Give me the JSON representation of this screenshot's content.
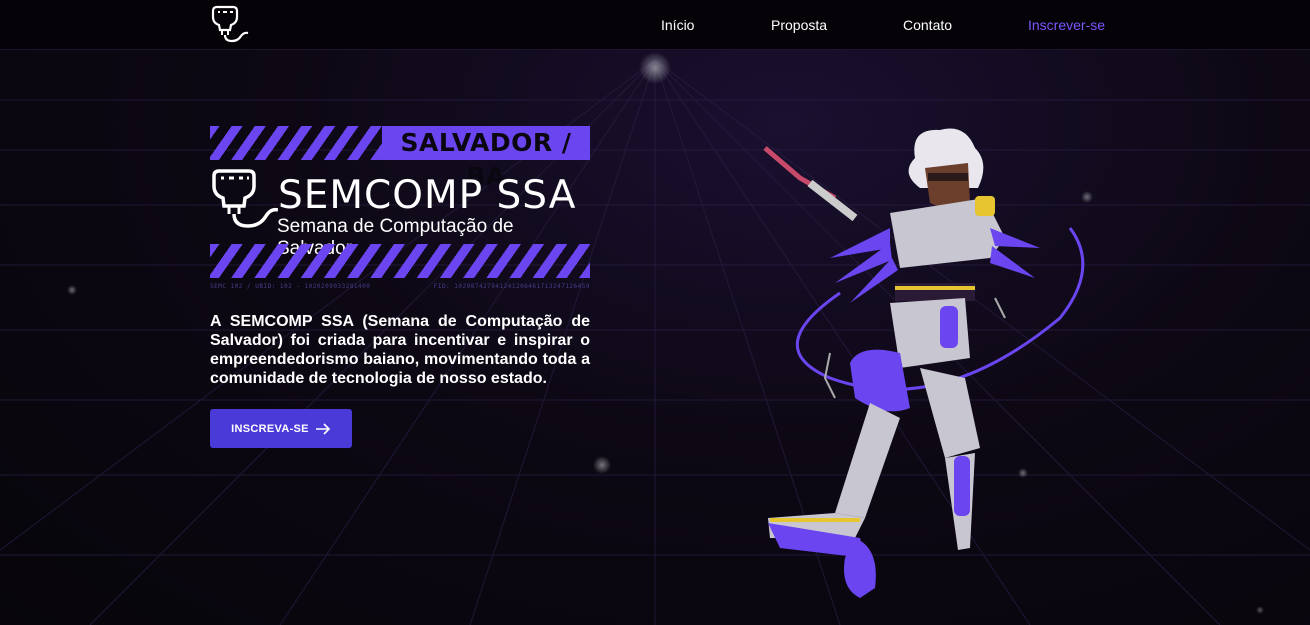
{
  "nav": {
    "links": [
      {
        "label": "Início"
      },
      {
        "label": "Proposta"
      },
      {
        "label": "Contato"
      },
      {
        "label": "Inscrever-se",
        "accent": true
      }
    ]
  },
  "hero": {
    "region_tag": "SALVADOR / BA",
    "title": "SEMCOMP SSA",
    "subtitle": "Semana de Computação de Salvador",
    "code_left": "SEMC 102 / UBID: 102 - 1020209033281400",
    "code_right": "FID: 102987427941241206461713247126459",
    "description": "A SEMCOMP SSA (Semana de Computação de Salvador) foi criada para incentivar e inspirar o empreendedorismo baiano, movimentando toda a comunidade de tecnologia de nosso estado.",
    "cta_label": "INSCREVA-SE"
  },
  "colors": {
    "accent": "#7c56ff",
    "stripe": "#6a45f0",
    "button": "#4a3ad8",
    "background": "#0b0710"
  },
  "icons": [
    "brain-plug-logo-icon",
    "arrow-right-icon"
  ]
}
